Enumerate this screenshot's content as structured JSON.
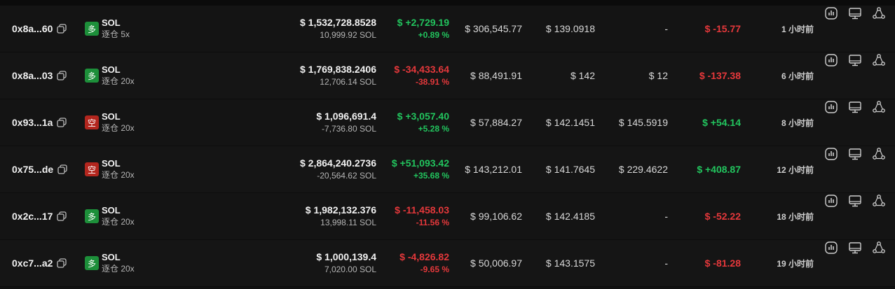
{
  "rows": [
    {
      "address": "0x8a...60",
      "side": "多",
      "side_type": "long",
      "asset": "SOL",
      "mode": "逐仓 5x",
      "value": "$ 1,532,728.8528",
      "size": "10,999.92 SOL",
      "pnl": "$ +2,729.19",
      "pnl_pct": "+0.89 %",
      "pnl_sign": "pos",
      "margin": "$ 306,545.77",
      "entry": "$ 139.0918",
      "liq": "-",
      "funding": "$ -15.77",
      "funding_sign": "neg",
      "time": "1 小时前"
    },
    {
      "address": "0x8a...03",
      "side": "多",
      "side_type": "long",
      "asset": "SOL",
      "mode": "逐仓 20x",
      "value": "$ 1,769,838.2406",
      "size": "12,706.14 SOL",
      "pnl": "$ -34,433.64",
      "pnl_pct": "-38.91 %",
      "pnl_sign": "neg",
      "margin": "$ 88,491.91",
      "entry": "$ 142",
      "liq": "$ 12",
      "funding": "$ -137.38",
      "funding_sign": "neg",
      "time": "6 小时前"
    },
    {
      "address": "0x93...1a",
      "side": "空",
      "side_type": "short",
      "asset": "SOL",
      "mode": "逐仓 20x",
      "value": "$ 1,096,691.4",
      "size": "-7,736.80 SOL",
      "pnl": "$ +3,057.40",
      "pnl_pct": "+5.28 %",
      "pnl_sign": "pos",
      "margin": "$ 57,884.27",
      "entry": "$ 142.1451",
      "liq": "$ 145.5919",
      "funding": "$ +54.14",
      "funding_sign": "pos",
      "time": "8 小时前"
    },
    {
      "address": "0x75...de",
      "side": "空",
      "side_type": "short",
      "asset": "SOL",
      "mode": "逐仓 20x",
      "value": "$ 2,864,240.2736",
      "size": "-20,564.62 SOL",
      "pnl": "$ +51,093.42",
      "pnl_pct": "+35.68 %",
      "pnl_sign": "pos",
      "margin": "$ 143,212.01",
      "entry": "$ 141.7645",
      "liq": "$ 229.4622",
      "funding": "$ +408.87",
      "funding_sign": "pos",
      "time": "12 小时前"
    },
    {
      "address": "0x2c...17",
      "side": "多",
      "side_type": "long",
      "asset": "SOL",
      "mode": "逐仓 20x",
      "value": "$ 1,982,132.376",
      "size": "13,998.11 SOL",
      "pnl": "$ -11,458.03",
      "pnl_pct": "-11.56 %",
      "pnl_sign": "neg",
      "margin": "$ 99,106.62",
      "entry": "$ 142.4185",
      "liq": "-",
      "funding": "$ -52.22",
      "funding_sign": "neg",
      "time": "18 小时前"
    },
    {
      "address": "0xc7...a2",
      "side": "多",
      "side_type": "long",
      "asset": "SOL",
      "mode": "逐仓 20x",
      "value": "$ 1,000,139.4",
      "size": "7,020.00 SOL",
      "pnl": "$ -4,826.82",
      "pnl_pct": "-9.65 %",
      "pnl_sign": "neg",
      "margin": "$ 50,006.97",
      "entry": "$ 143.1575",
      "liq": "-",
      "funding": "$ -81.28",
      "funding_sign": "neg",
      "time": "19 小时前"
    }
  ],
  "icons": {
    "copy": "copy-icon",
    "chart": "chart-icon",
    "monitor": "monitor-icon",
    "share": "share-icon"
  },
  "colors": {
    "positive": "#22c55e",
    "negative": "#e5383b",
    "long_badge": "#1d8f3a",
    "short_badge": "#b3261e",
    "background": "#111111"
  }
}
